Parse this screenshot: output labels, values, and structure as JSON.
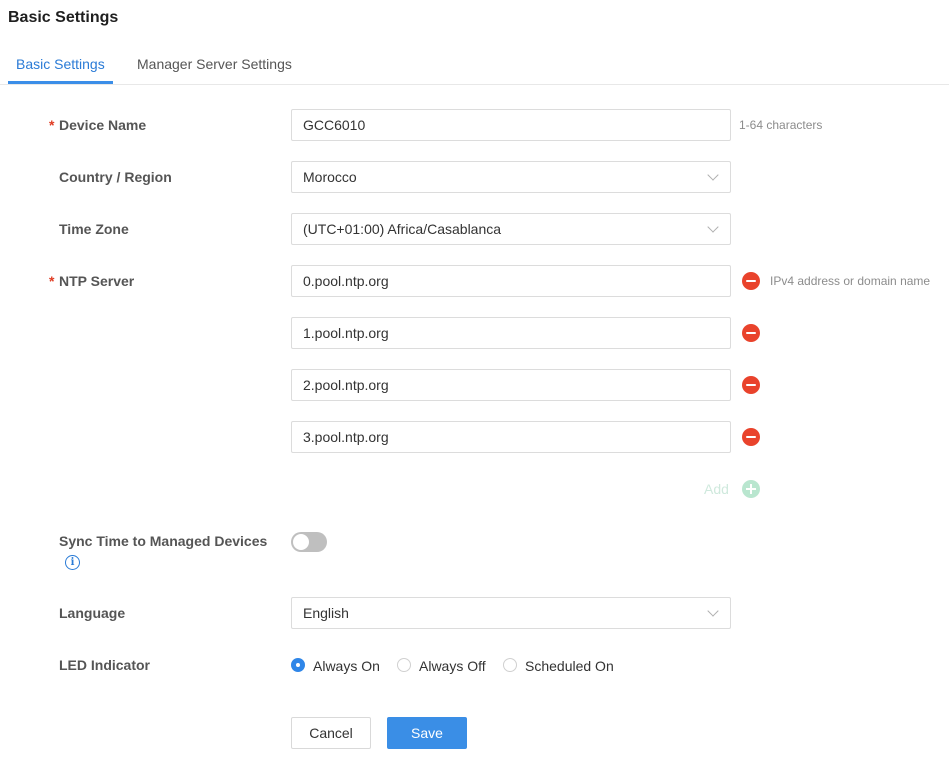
{
  "page_title": "Basic Settings",
  "tabs": [
    {
      "label": "Basic Settings",
      "active": true
    },
    {
      "label": "Manager Server Settings",
      "active": false
    }
  ],
  "form": {
    "required_mark": "*",
    "device_name": {
      "label": "Device Name",
      "value": "GCC6010",
      "hint": "1-64 characters"
    },
    "country_region": {
      "label": "Country / Region",
      "value": "Morocco"
    },
    "time_zone": {
      "label": "Time Zone",
      "value": "(UTC+01:00) Africa/Casablanca"
    },
    "ntp_server": {
      "label": "NTP Server",
      "hint": "IPv4 address or domain name",
      "servers": [
        "0.pool.ntp.org",
        "1.pool.ntp.org",
        "2.pool.ntp.org",
        "3.pool.ntp.org"
      ],
      "add_label": "Add"
    },
    "sync_time": {
      "label": "Sync Time to Managed Devices",
      "enabled": false,
      "info_icon": "i"
    },
    "language": {
      "label": "Language",
      "value": "English"
    },
    "led_indicator": {
      "label": "LED Indicator",
      "options": [
        "Always On",
        "Always Off",
        "Scheduled On"
      ],
      "selected": "Always On"
    }
  },
  "actions": {
    "cancel_label": "Cancel",
    "save_label": "Save"
  },
  "colors": {
    "accent": "#3a8ee6",
    "danger": "#e9432c",
    "add_disabled": "#b9e6cf"
  }
}
